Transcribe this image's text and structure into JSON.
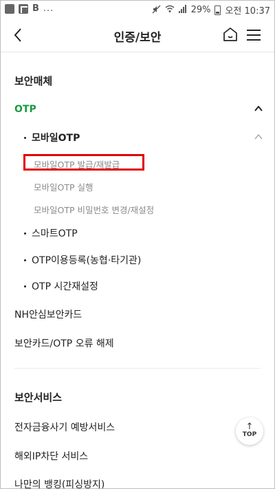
{
  "status_bar": {
    "left_icons": [
      "image-icon",
      "flipboard-icon"
    ],
    "left_text_b": "B",
    "left_more": "...",
    "battery_text": "29%",
    "time": "오전 10:37"
  },
  "header": {
    "title": "인증/보안"
  },
  "sections": {
    "security_media": {
      "title": "보안매체",
      "otp": {
        "label": "OTP",
        "mobile_otp": {
          "label": "모바일OTP",
          "children": [
            "모바일OTP 발급/재발급",
            "모바일OTP 실행",
            "모바일OTP 비밀번호 변경/재설정"
          ]
        },
        "smart_otp": "스마트OTP",
        "otp_register": "OTP이용등록(농협·타기관)",
        "otp_time_reset": "OTP 시간재설정"
      },
      "nh_card": "NH안심보안카드",
      "error_release": "보안카드/OTP 오류 해제"
    },
    "security_service": {
      "title": "보안서비스",
      "items": [
        "전자금융사기 예방서비스",
        "해외IP차단 서비스",
        "나만의 뱅킹(피싱방지)"
      ]
    }
  },
  "top_button": {
    "label": "TOP"
  },
  "colors": {
    "accent_green": "#1a9a3f",
    "highlight_red": "#e20000"
  }
}
